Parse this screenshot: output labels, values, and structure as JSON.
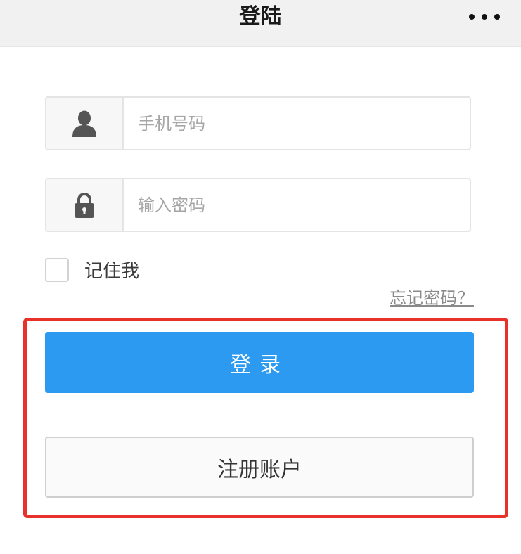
{
  "header": {
    "title": "登陆",
    "more_icon": "more-dots-icon"
  },
  "form": {
    "phone": {
      "icon": "user-icon",
      "placeholder": "手机号码",
      "value": ""
    },
    "password": {
      "icon": "lock-icon",
      "placeholder": "输入密码",
      "value": ""
    },
    "remember_label": "记住我",
    "remember_checked": false,
    "forgot_label": "忘记密码？"
  },
  "actions": {
    "login_label": "登录",
    "register_label": "注册账户"
  },
  "colors": {
    "primary": "#2b9af0",
    "highlight": "#e8312b",
    "header_bg": "#f1f1f1"
  }
}
